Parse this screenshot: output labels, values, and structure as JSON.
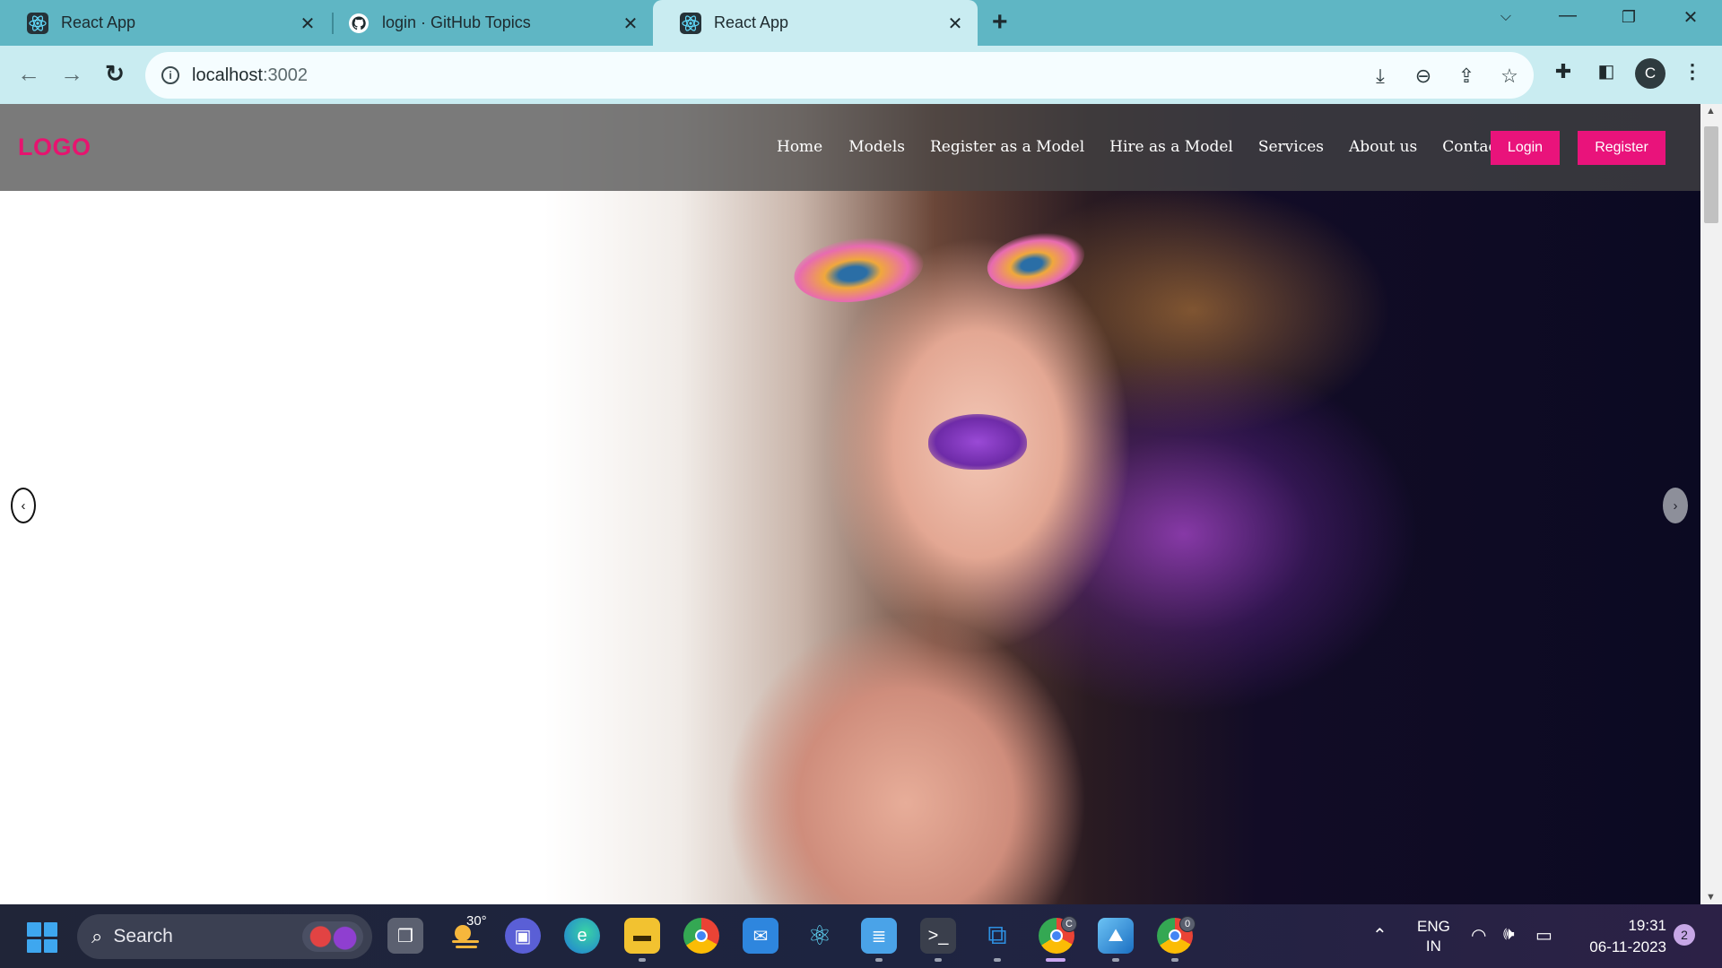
{
  "browser": {
    "tabs": [
      {
        "title": "React App",
        "icon": "react-icon",
        "active": false
      },
      {
        "title": "login · GitHub Topics",
        "icon": "github-icon",
        "active": false
      },
      {
        "title": "React App",
        "icon": "react-icon",
        "active": true
      }
    ],
    "address": {
      "host": "localhost",
      "port": ":3002"
    },
    "profile_initial": "C"
  },
  "site": {
    "logo": "LOGO",
    "nav": [
      "Home",
      "Models",
      "Register as a Model",
      "Hire as a Model",
      "Services",
      "About us",
      "Contact us"
    ],
    "login_label": "Login",
    "register_label": "Register",
    "carousel": {
      "prev": "‹",
      "next": "›"
    },
    "accent_color": "#e9137b"
  },
  "taskbar": {
    "search_label": "Search",
    "weather_temp": "30°",
    "lang_top": "ENG",
    "lang_bottom": "IN",
    "time": "19:31",
    "date": "06-11-2023",
    "notification_count": "2",
    "chrome_badge_1": "C",
    "chrome_badge_2": "0"
  }
}
